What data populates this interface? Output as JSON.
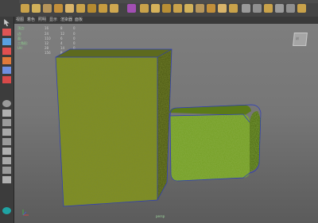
{
  "menubar": {
    "items": [
      "视图",
      "着色",
      "照明",
      "显示",
      "渲染器",
      "面板"
    ]
  },
  "hud": {
    "rows": [
      {
        "label": "顶点:",
        "v1": "16",
        "v2": "8",
        "v3": "0"
      },
      {
        "label": "边:",
        "v1": "24",
        "v2": "12",
        "v3": "0"
      },
      {
        "label": "面:",
        "v1": "110",
        "v2": "6",
        "v3": "0"
      },
      {
        "label": "三角形:",
        "v1": "12",
        "v2": "4",
        "v3": "0"
      },
      {
        "label": "UV:",
        "v1": "28",
        "v2": "14",
        "v3": "0"
      },
      {
        "label": "",
        "v1": "156",
        "v2": "8",
        "v3": "0"
      }
    ]
  },
  "viewcube": {
    "label": "前"
  },
  "camera": {
    "label": "persp"
  },
  "colors": {
    "hud_label": "#8fd18f",
    "grass_dark": "#3d4a12",
    "grass_light": "#8a9a2a",
    "wire": "#2b3bbd"
  }
}
